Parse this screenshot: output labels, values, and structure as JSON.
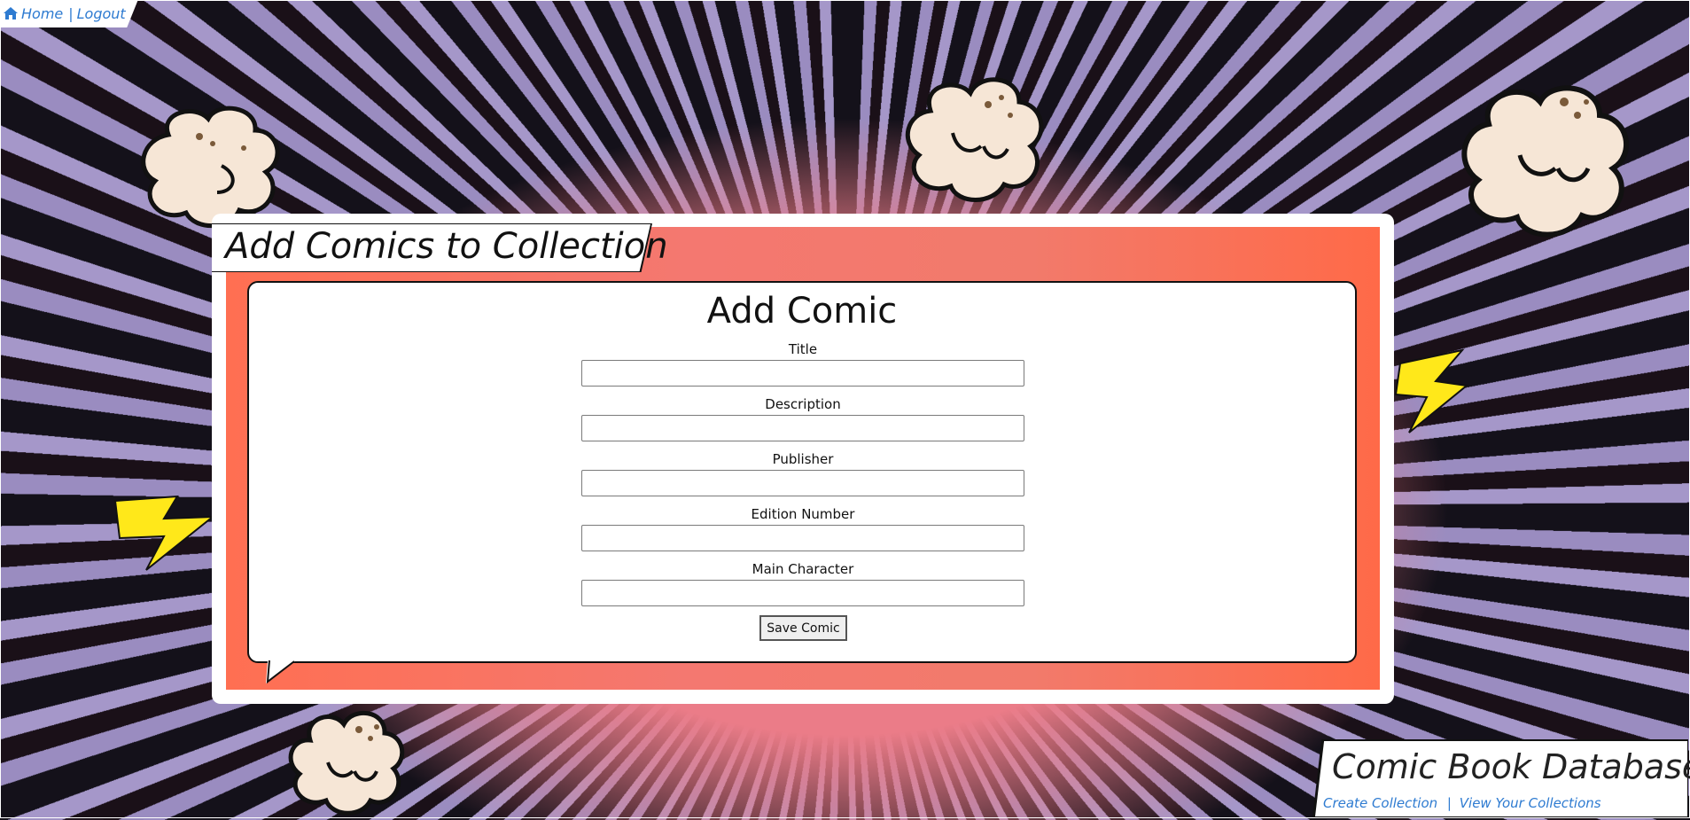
{
  "nav": {
    "home_icon": "home-icon",
    "home_label": "Home",
    "separator": "|",
    "logout_label": "Logout"
  },
  "panel": {
    "title": "Add Comics to Collection"
  },
  "form": {
    "title": "Add Comic",
    "fields": [
      {
        "label": "Title",
        "value": ""
      },
      {
        "label": "Description",
        "value": ""
      },
      {
        "label": "Publisher",
        "value": ""
      },
      {
        "label": "Edition Number",
        "value": ""
      },
      {
        "label": "Main Character",
        "value": ""
      }
    ],
    "submit_label": "Save Comic"
  },
  "footer": {
    "brand": "Comic Book Database",
    "create_label": "Create Collection",
    "separator": "|",
    "view_label": "View Your Collections"
  },
  "colors": {
    "link": "#2e7bd1",
    "panel_accent": "#f47870",
    "background_pink": "#e8818a",
    "ray_purple": "#9a8cc0"
  }
}
